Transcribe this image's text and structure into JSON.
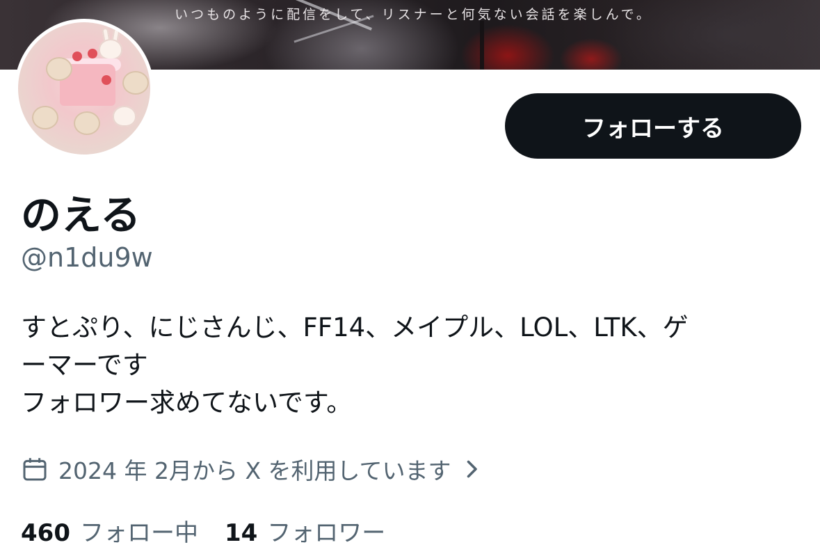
{
  "banner": {
    "text": "いつものように配信をして、リスナーと何気ない会話を楽しんで。"
  },
  "profile": {
    "display_name": "のえる",
    "handle": "@n1du9w",
    "bio_lines": [
      "すとぷり、にじさんじ、FF14、メイプル、LOL、LTK、ゲ",
      "ーマーです",
      "フォロワー求めてないです。"
    ],
    "joined": "2024 年 2月から X を利用しています"
  },
  "actions": {
    "follow_label": "フォローする"
  },
  "stats": {
    "following_count": "460",
    "following_label": "フォロー中",
    "followers_count": "14",
    "followers_label": "フォロワー"
  },
  "icons": {
    "calendar": "calendar-icon",
    "chevron": "chevron-right-icon"
  },
  "colors": {
    "text_primary": "#0f1419",
    "text_secondary": "#536471",
    "button_bg": "#0f1419",
    "button_text": "#ffffff"
  }
}
